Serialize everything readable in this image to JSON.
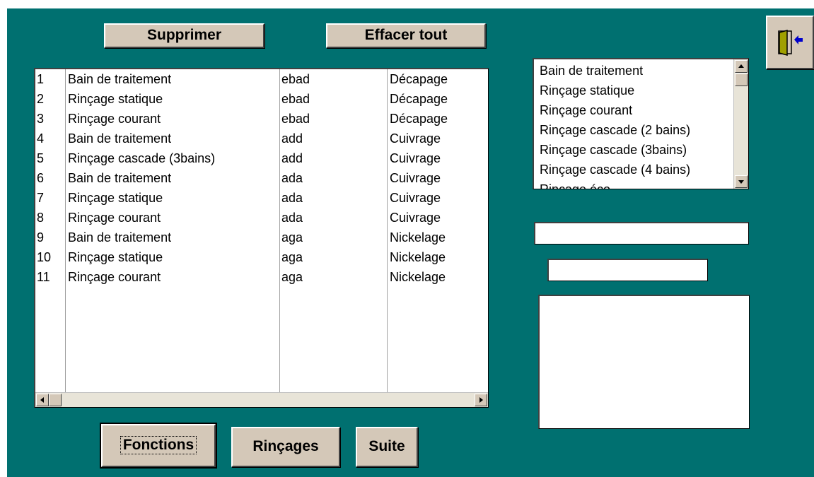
{
  "toolbar": {
    "delete_label": "Supprimer",
    "clear_all_label": "Effacer tout"
  },
  "footer": {
    "functions_label": "Fonctions",
    "rinses_label": "Rinçages",
    "next_label": "Suite"
  },
  "exit_icon": "door-exit-icon",
  "main_list": {
    "rows": [
      {
        "num": "1",
        "name": "Bain de traitement",
        "code": "ebad",
        "operation": "Décapage"
      },
      {
        "num": "2",
        "name": "Rinçage statique",
        "code": "ebad",
        "operation": "Décapage"
      },
      {
        "num": "3",
        "name": "Rinçage courant",
        "code": "ebad",
        "operation": "Décapage"
      },
      {
        "num": "4",
        "name": "Bain de traitement",
        "code": "add",
        "operation": "Cuivrage"
      },
      {
        "num": "5",
        "name": "Rinçage cascade (3bains)",
        "code": "add",
        "operation": "Cuivrage"
      },
      {
        "num": "6",
        "name": "Bain de traitement",
        "code": "ada",
        "operation": "Cuivrage"
      },
      {
        "num": "7",
        "name": "Rinçage statique",
        "code": "ada",
        "operation": "Cuivrage"
      },
      {
        "num": "8",
        "name": "Rinçage courant",
        "code": "ada",
        "operation": "Cuivrage"
      },
      {
        "num": "9",
        "name": "Bain de traitement",
        "code": "aga",
        "operation": "Nickelage"
      },
      {
        "num": "10",
        "name": "Rinçage statique",
        "code": "aga",
        "operation": "Nickelage"
      },
      {
        "num": "11",
        "name": "Rinçage courant",
        "code": "aga",
        "operation": "Nickelage"
      }
    ]
  },
  "right_list": {
    "items": [
      "Bain de traitement",
      "Rinçage statique",
      "Rinçage courant",
      "Rinçage cascade (2 bains)",
      "Rinçage cascade (3bains)",
      "Rinçage cascade (4 bains)",
      "Rinçage éco"
    ]
  },
  "fields": {
    "field_1_value": "",
    "field_2_value": "",
    "memo_value": ""
  },
  "colors": {
    "background": "#007070",
    "button_face": "#d4c8b8",
    "exit_arrow": "#0000cc",
    "door": "#a0a000"
  }
}
